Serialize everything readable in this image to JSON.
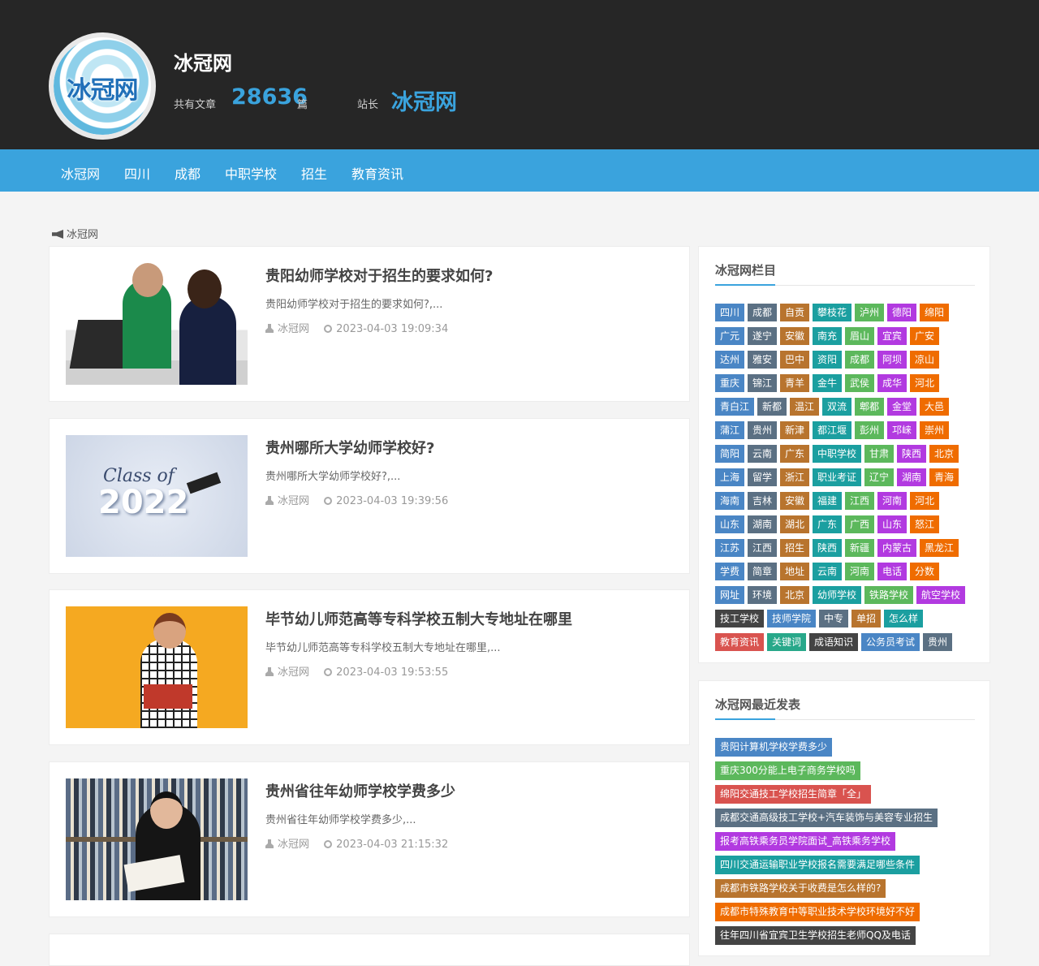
{
  "header": {
    "logo_text": "冰冠网",
    "site_title": "冰冠网",
    "articles_label": "共有文章",
    "articles_count": "28636",
    "articles_unit": "篇",
    "owner_label": "站长",
    "owner_name": "冰冠网"
  },
  "nav": {
    "items": [
      "冰冠网",
      "四川",
      "成都",
      "中职学校",
      "招生",
      "教育资讯"
    ]
  },
  "breadcrumb": {
    "label": "冰冠网"
  },
  "articles": [
    {
      "title": "贵阳幼师学校对于招生的要求如何?",
      "excerpt": "贵阳幼师学校对于招生的要求如何?,...",
      "author": "冰冠网",
      "date": "2023-04-03 19:09:34"
    },
    {
      "title": "贵州哪所大学幼师学校好?",
      "excerpt": "贵州哪所大学幼师学校好?,...",
      "author": "冰冠网",
      "date": "2023-04-03 19:39:56"
    },
    {
      "title": "毕节幼儿师范高等专科学校五制大专地址在哪里",
      "excerpt": "毕节幼儿师范高等专科学校五制大专地址在哪里,...",
      "author": "冰冠网",
      "date": "2023-04-03 19:53:55"
    },
    {
      "title": "贵州省往年幼师学校学费多少",
      "excerpt": "贵州省往年幼师学校学费多少,...",
      "author": "冰冠网",
      "date": "2023-04-03 21:15:32"
    }
  ],
  "thumb_2": {
    "class_text": "Class of",
    "year_text": "2022"
  },
  "categories_widget": {
    "title": "冰冠网栏目",
    "tags": [
      [
        "四川",
        "成都",
        "自贡",
        "攀枝花",
        "泸州",
        "德阳",
        "绵阳"
      ],
      [
        "广元",
        "遂宁",
        "安徽",
        "南充",
        "眉山",
        "宜宾",
        "广安"
      ],
      [
        "达州",
        "雅安",
        "巴中",
        "资阳",
        "成都",
        "阿坝",
        "凉山"
      ],
      [
        "重庆",
        "锦江",
        "青羊",
        "金牛",
        "武侯",
        "成华",
        "河北"
      ],
      [
        "青白江",
        "新都",
        "温江",
        "双流",
        "郫都",
        "金堂",
        "大邑"
      ],
      [
        "蒲江",
        "贵州",
        "新津",
        "都江堰",
        "彭州",
        "邛崃",
        "崇州"
      ],
      [
        "简阳",
        "云南",
        "广东",
        "中职学校",
        "甘肃",
        "陕西",
        "北京"
      ],
      [
        "上海",
        "留学",
        "浙江",
        "职业考证",
        "辽宁",
        "湖南",
        "青海"
      ],
      [
        "海南",
        "吉林",
        "安徽",
        "福建",
        "江西",
        "河南",
        "河北"
      ],
      [
        "山东",
        "湖南",
        "湖北",
        "广东",
        "广西",
        "山东",
        "怒江"
      ],
      [
        "江苏",
        "江西",
        "招生",
        "陕西",
        "新疆",
        "内蒙古",
        "黑龙江"
      ],
      [
        "学费",
        "简章",
        "地址",
        "云南",
        "河南",
        "电话",
        "分数"
      ],
      [
        "网址",
        "环境",
        "北京",
        "幼师学校",
        "铁路学校",
        "航空学校"
      ],
      [
        "技工学校",
        "技师学院",
        "中专",
        "单招",
        "怎么样"
      ],
      [
        "教育资讯",
        "关键词",
        "成语知识",
        "公务员考试",
        "贵州"
      ]
    ],
    "palette": [
      "#4a86c5",
      "#5cb85c",
      "#d9534f",
      "#5b7083",
      "#b23ae0",
      "#28a88a",
      "#b8742e",
      "#ef6c00",
      "#444444",
      "#1b9fa0",
      "#3a8fd8"
    ]
  },
  "recent_widget": {
    "title": "冰冠网最近发表",
    "posts": [
      {
        "label": "贵阳计算机学校学费多少",
        "color": "#4a86c5"
      },
      {
        "label": "重庆300分能上电子商务学校吗",
        "color": "#5cb85c"
      },
      {
        "label": "绵阳交通技工学校招生简章「全」",
        "color": "#d9534f"
      },
      {
        "label": "成都交通高级技工学校+汽车装饰与美容专业招生",
        "color": "#5b7083"
      },
      {
        "label": "报考高铁乘务员学院面试_高铁乘务学校",
        "color": "#b23ae0"
      },
      {
        "label": "四川交通运输职业学校报名需要满足哪些条件",
        "color": "#1b9fa0"
      },
      {
        "label": "成都市铁路学校关于收费是怎么样的?",
        "color": "#b8742e"
      },
      {
        "label": "成都市特殊教育中等职业技术学校环境好不好",
        "color": "#ef6c00"
      },
      {
        "label": "往年四川省宜宾卫生学校招生老师QQ及电话",
        "color": "#444444"
      }
    ]
  }
}
